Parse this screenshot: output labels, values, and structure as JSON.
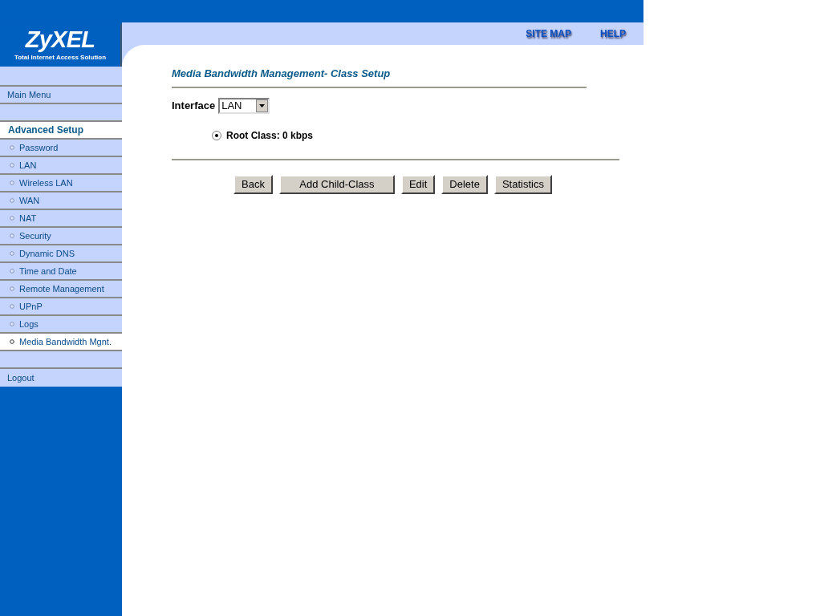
{
  "logo": {
    "name": "ZyXEL",
    "tagline": "Total Internet Access Solution"
  },
  "top_links": [
    "SITE MAP",
    "HELP"
  ],
  "sidebar": {
    "main_menu": "Main Menu",
    "section": {
      "title": "Advanced Setup",
      "items": [
        {
          "label": "Password",
          "selected": false
        },
        {
          "label": "LAN",
          "selected": false
        },
        {
          "label": "Wireless LAN",
          "selected": false
        },
        {
          "label": "WAN",
          "selected": false
        },
        {
          "label": "NAT",
          "selected": false
        },
        {
          "label": "Security",
          "selected": false
        },
        {
          "label": "Dynamic DNS",
          "selected": false
        },
        {
          "label": "Time and Date",
          "selected": false
        },
        {
          "label": "Remote Management",
          "selected": false
        },
        {
          "label": "UPnP",
          "selected": false
        },
        {
          "label": "Logs",
          "selected": false
        },
        {
          "label": "Media Bandwidth Mgnt.",
          "selected": true
        }
      ]
    },
    "logout": "Logout"
  },
  "page": {
    "title": "Media Bandwidth Management- Class Setup",
    "interface_label": "Interface",
    "interface_value": "LAN",
    "classes": [
      {
        "label": "Root Class: 0 kbps",
        "selected": true
      }
    ],
    "buttons": [
      "Back",
      "Add Child-Class",
      "Edit",
      "Delete",
      "Statistics"
    ]
  }
}
